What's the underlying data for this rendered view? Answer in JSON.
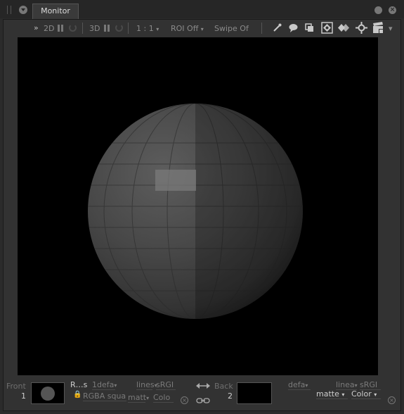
{
  "tab": {
    "title": "Monitor"
  },
  "window": {
    "close_symbol": "×"
  },
  "toolbar": {
    "expand": "»",
    "mode_2d": "2D",
    "mode_3d": "3D",
    "ratio": "1 : 1",
    "roi": "ROI Off",
    "swipe": "Swipe Of",
    "caret": "▾",
    "icons": [
      "eyedropper-icon",
      "comment-icon",
      "copy-icon",
      "zoom-fit-icon",
      "diamond-icon",
      "target-icon",
      "clapper-icon"
    ]
  },
  "bottom": {
    "front": {
      "label": "Front",
      "number": "1",
      "name": "R…s",
      "layer": "1defa",
      "lut_left": "lines",
      "lut_right": "sRGI",
      "channels": "RGBA squal",
      "matte": "matt",
      "color": "Colo"
    },
    "back": {
      "label": "Back",
      "number": "2",
      "layer": "defa",
      "lut_left": "linea",
      "lut_right": "sRGI",
      "matte": "matte",
      "color": "Color"
    },
    "close_symbol": "×"
  }
}
